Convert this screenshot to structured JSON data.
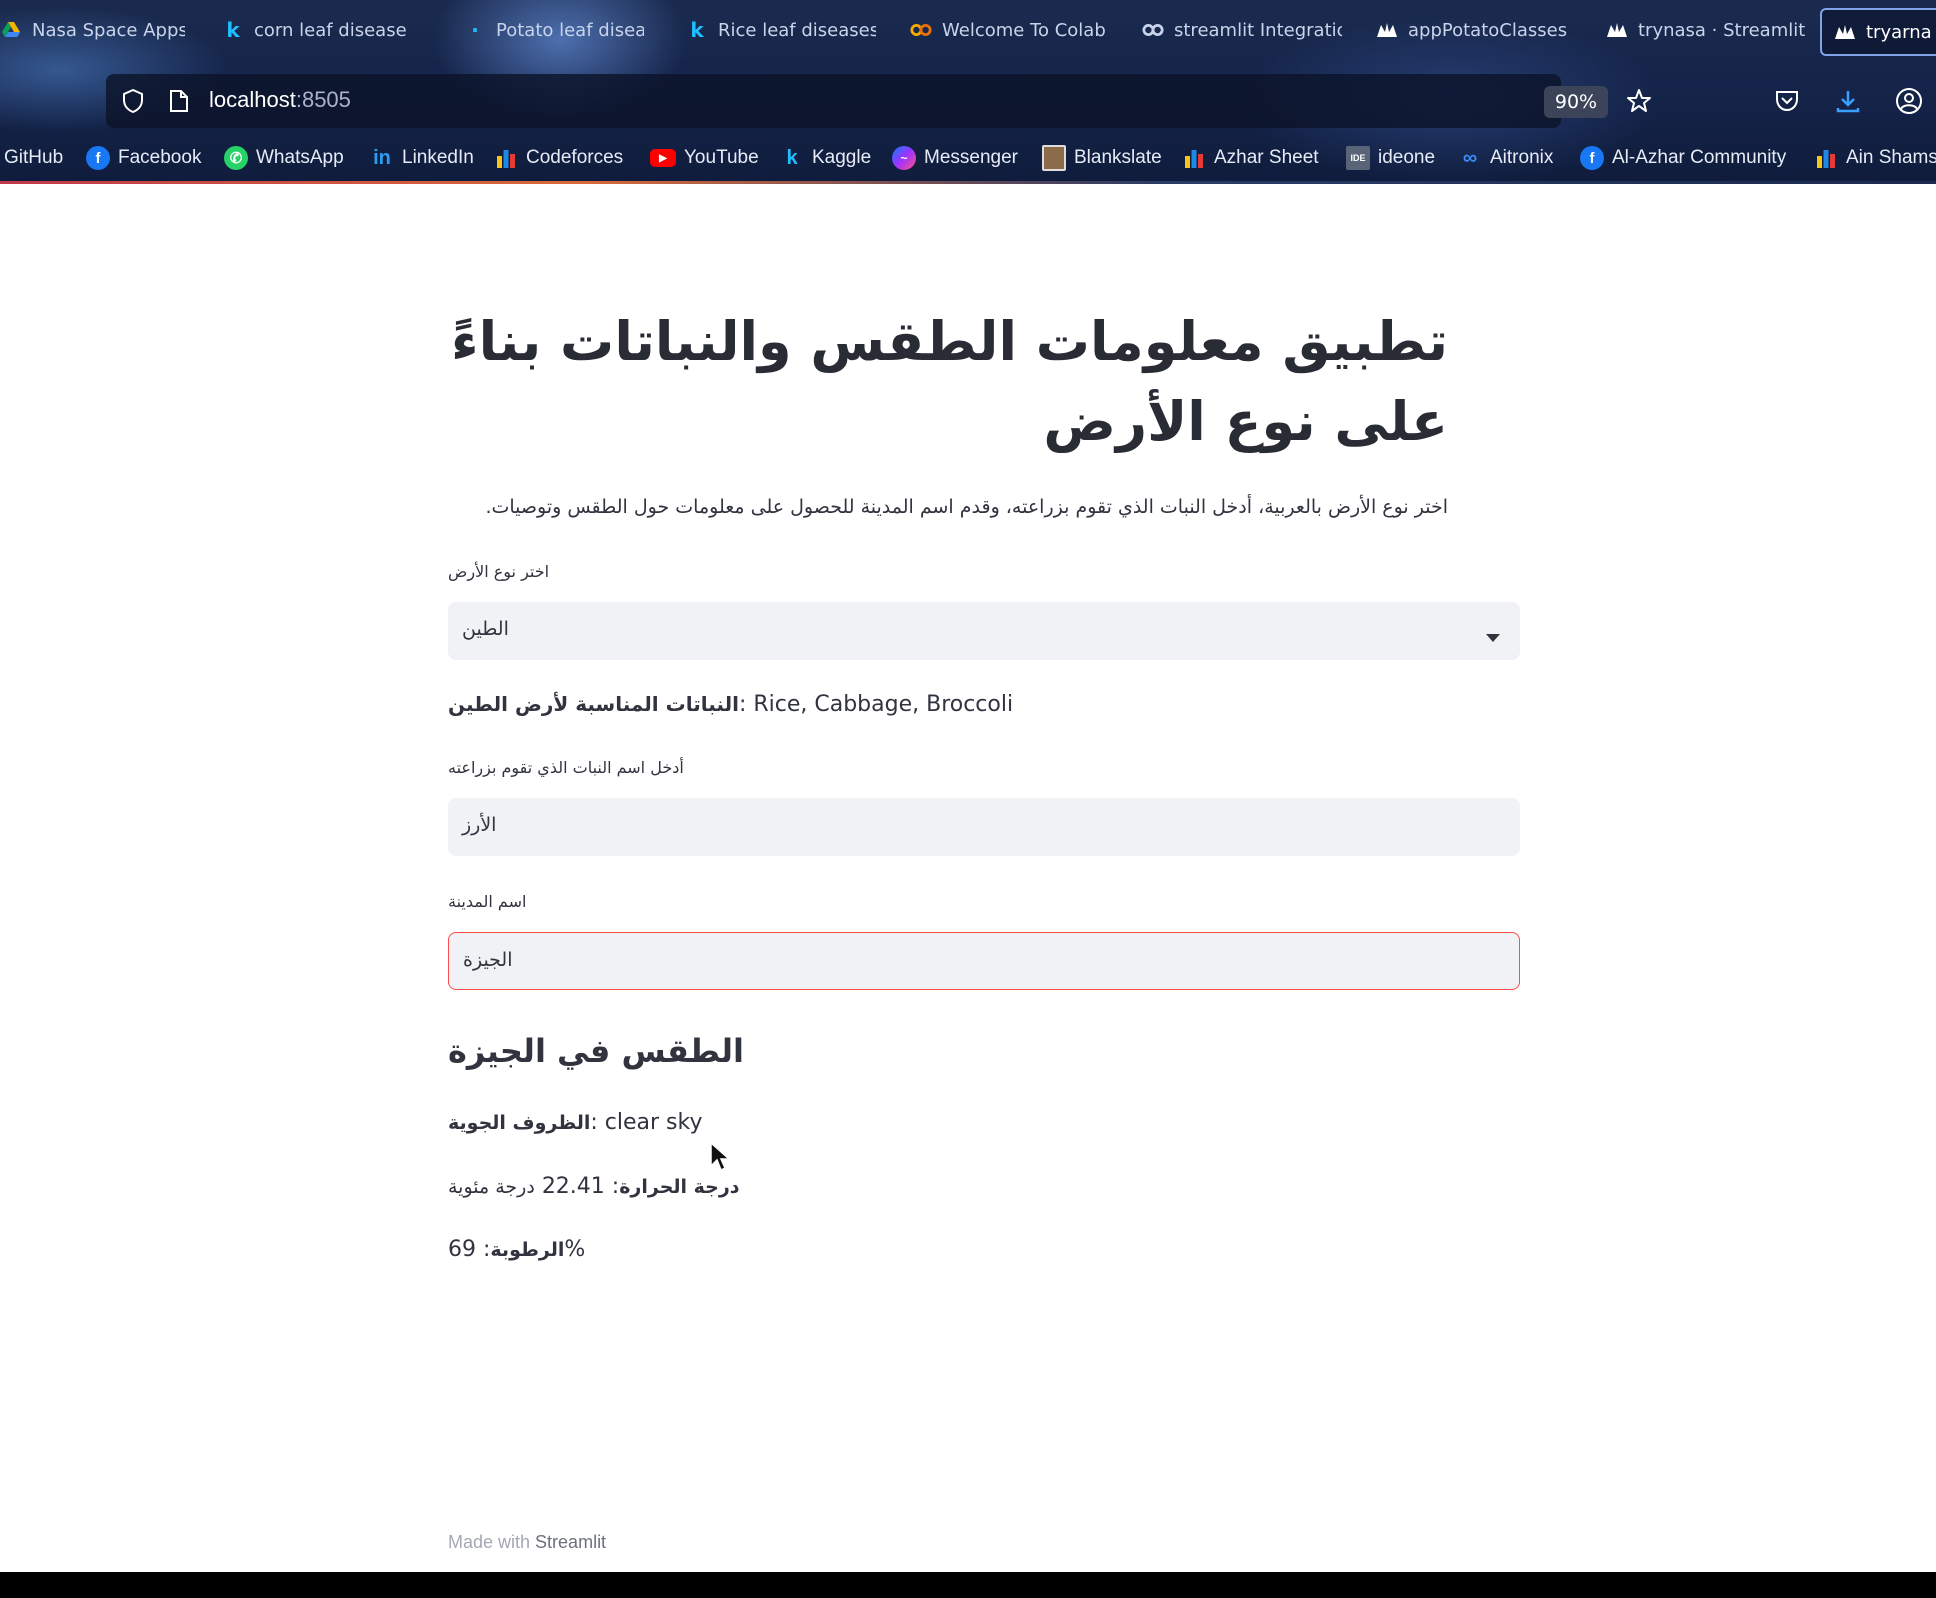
{
  "browser": {
    "tabs": [
      {
        "label": "Nasa Space Apps",
        "icon": "drive-icon"
      },
      {
        "label": "corn leaf disease",
        "icon": "kaggle-icon"
      },
      {
        "label": "Potato leaf diseas",
        "icon": "kaggle-icon"
      },
      {
        "label": "Rice leaf diseases",
        "icon": "kaggle-icon"
      },
      {
        "label": "Welcome To Colab",
        "icon": "colab-icon"
      },
      {
        "label": "streamlit Integratio",
        "icon": "colab-icon"
      },
      {
        "label": "appPotatoClasses",
        "icon": "streamlit-icon"
      },
      {
        "label": "trynasa · Streamlit",
        "icon": "streamlit-icon"
      },
      {
        "label": "tryarna",
        "icon": "streamlit-icon"
      }
    ],
    "url_host": "localhost",
    "url_port": ":8505",
    "zoom": "90%",
    "bookmarks": [
      {
        "label": "GitHub",
        "icon": "github-icon"
      },
      {
        "label": "Facebook",
        "icon": "facebook-icon"
      },
      {
        "label": "WhatsApp",
        "icon": "whatsapp-icon"
      },
      {
        "label": "LinkedIn",
        "icon": "linkedin-icon"
      },
      {
        "label": "Codeforces",
        "icon": "codeforces-icon"
      },
      {
        "label": "YouTube",
        "icon": "youtube-icon"
      },
      {
        "label": "Kaggle",
        "icon": "kaggle-icon"
      },
      {
        "label": "Messenger",
        "icon": "messenger-icon"
      },
      {
        "label": "Blankslate",
        "icon": "blankslate-icon"
      },
      {
        "label": "Azhar Sheet",
        "icon": "codeforces-icon"
      },
      {
        "label": "ideone",
        "icon": "ideone-icon"
      },
      {
        "label": "Aitronix",
        "icon": "meta-icon"
      },
      {
        "label": "Al-Azhar Community",
        "icon": "facebook-icon"
      },
      {
        "label": "Ain Shams",
        "icon": "codeforces-icon"
      }
    ]
  },
  "app": {
    "title": "تطبيق معلومات الطقس والنباتات بناءً على نوع الأرض",
    "description": "اختر نوع الأرض بالعربية، أدخل النبات الذي تقوم بزراعته، وقدم اسم المدينة للحصول على معلومات حول الطقس وتوصيات.",
    "soil_label": "اختر نوع الأرض",
    "soil_value": "الطين",
    "suitable_plants_label": "النباتات المناسبة لأرض الطين",
    "suitable_plants_value": ": Rice, Cabbage, Broccoli",
    "plant_label": "أدخل اسم النبات الذي تقوم بزراعته",
    "plant_value": "الأرز",
    "city_label": "اسم المدينة",
    "city_value": "الجيزة",
    "weather_heading": "الطقس في الجيزة",
    "conditions_label": "الظروف الجوية",
    "conditions_value": ": clear sky",
    "temperature_label": "درجة الحرارة",
    "temperature_value": ": 22.41",
    "temperature_unit": "درجة مئوية",
    "humidity_label": "الرطوبة",
    "humidity_value": ": 69",
    "humidity_unit": "%",
    "footer_prefix": "Made with ",
    "footer_brand": "Streamlit"
  },
  "colors": {
    "accent": "#ff4b4b",
    "input_bg": "#f0f2f6",
    "text": "#31333f"
  }
}
